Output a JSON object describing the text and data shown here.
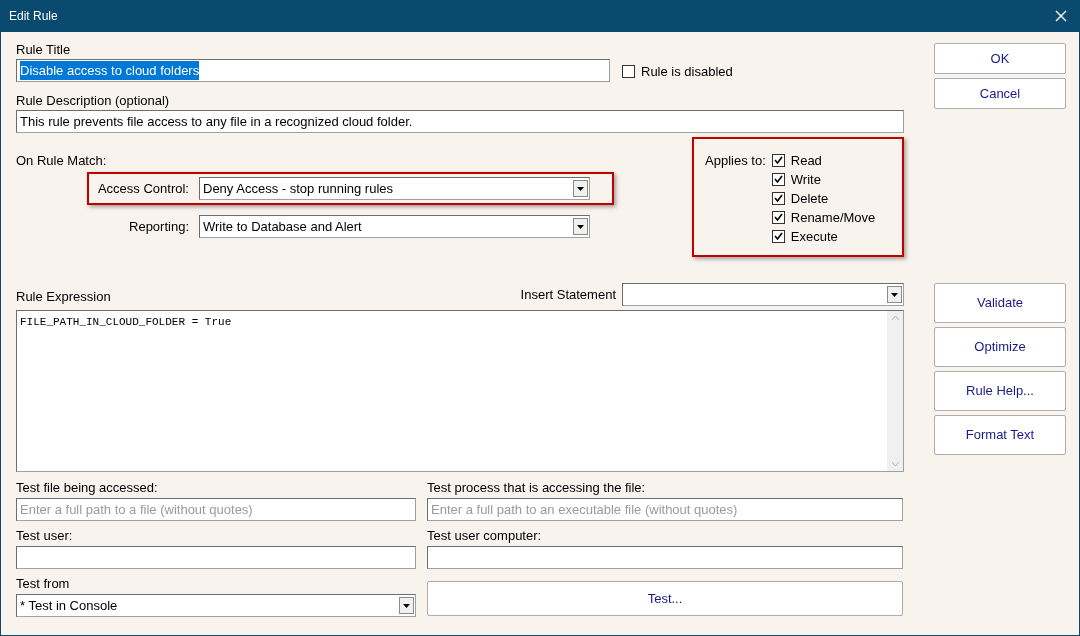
{
  "window": {
    "title": "Edit Rule"
  },
  "rule_title": {
    "label": "Rule Title",
    "value": "Disable access to cloud folders",
    "text_selected": true
  },
  "rule_disabled": {
    "label": "Rule is disabled",
    "checked": false
  },
  "rule_description": {
    "label": "Rule Description (optional)",
    "value": "This rule prevents file access to any file in a recognized cloud folder."
  },
  "on_rule_match": {
    "label": "On Rule Match:",
    "access_control": {
      "label": "Access Control:",
      "value": "Deny Access - stop running rules",
      "highlighted": true
    },
    "reporting": {
      "label": "Reporting:",
      "value": "Write to Database and Alert",
      "highlighted": false
    }
  },
  "applies_to": {
    "label": "Applies to:",
    "highlighted": true,
    "options": [
      {
        "label": "Read",
        "checked": true
      },
      {
        "label": "Write",
        "checked": true
      },
      {
        "label": "Delete",
        "checked": true
      },
      {
        "label": "Rename/Move",
        "checked": true
      },
      {
        "label": "Execute",
        "checked": true
      }
    ]
  },
  "rule_expression": {
    "label": "Rule Expression",
    "value": "FILE_PATH_IN_CLOUD_FOLDER = True"
  },
  "insert_statement": {
    "label": "Insert Statement"
  },
  "test_file": {
    "label": "Test file being accessed:",
    "placeholder": "Enter a full path to a file (without quotes)"
  },
  "test_process": {
    "label": "Test process that is accessing the file:",
    "placeholder": "Enter a full path to an executable file (without quotes)"
  },
  "test_user": {
    "label": "Test user:"
  },
  "test_user_computer": {
    "label": "Test user computer:"
  },
  "test_from": {
    "label": "Test from",
    "value": "* Test in Console"
  },
  "test_button": "Test...",
  "dialog_buttons": [
    "OK",
    "Cancel"
  ],
  "tool_buttons": [
    "Validate",
    "Optimize",
    "Rule Help...",
    "Format Text"
  ]
}
